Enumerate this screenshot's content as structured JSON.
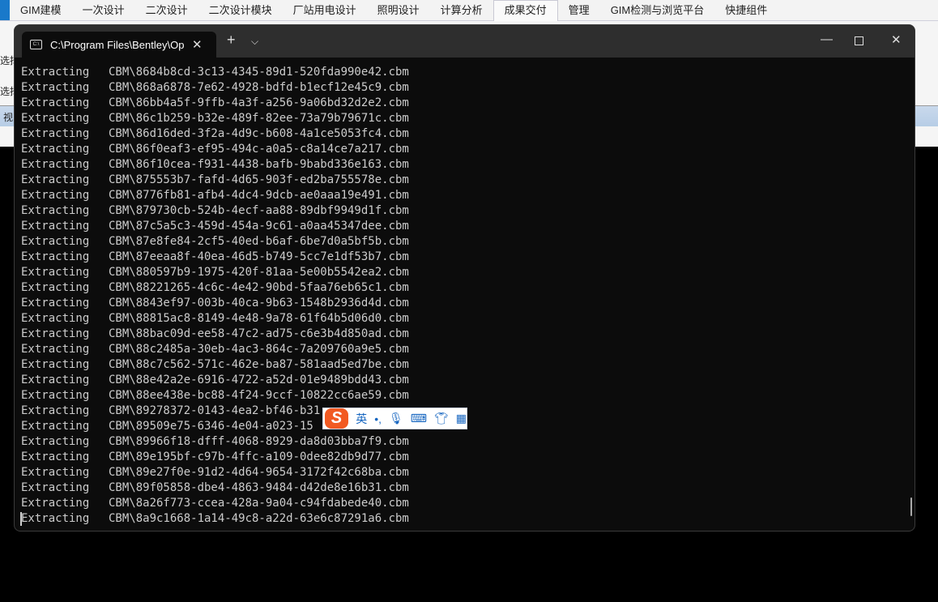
{
  "ribbon": {
    "tabs": [
      "GIM建模",
      "一次设计",
      "二次设计",
      "二次设计模块",
      "厂站用电设计",
      "照明设计",
      "计算分析",
      "成果交付",
      "管理",
      "GIM检测与浏览平台",
      "快捷组件"
    ],
    "active": "成果交付"
  },
  "background_app": {
    "labels": [
      "选择",
      "选择",
      "视"
    ]
  },
  "terminal": {
    "tab_title": "C:\\Program Files\\Bentley\\Ope",
    "tab_icon": "console-icon",
    "lines": [
      [
        "Extracting",
        "CBM\\8684b8cd-3c13-4345-89d1-520fda990e42.cbm"
      ],
      [
        "Extracting",
        "CBM\\868a6878-7e62-4928-bdfd-b1ecf12e45c9.cbm"
      ],
      [
        "Extracting",
        "CBM\\86bb4a5f-9ffb-4a3f-a256-9a06bd32d2e2.cbm"
      ],
      [
        "Extracting",
        "CBM\\86c1b259-b32e-489f-82ee-73a79b79671c.cbm"
      ],
      [
        "Extracting",
        "CBM\\86d16ded-3f2a-4d9c-b608-4a1ce5053fc4.cbm"
      ],
      [
        "Extracting",
        "CBM\\86f0eaf3-ef95-494c-a0a5-c8a14ce7a217.cbm"
      ],
      [
        "Extracting",
        "CBM\\86f10cea-f931-4438-bafb-9babd336e163.cbm"
      ],
      [
        "Extracting",
        "CBM\\875553b7-fafd-4d65-903f-ed2ba755578e.cbm"
      ],
      [
        "Extracting",
        "CBM\\8776fb81-afb4-4dc4-9dcb-ae0aaa19e491.cbm"
      ],
      [
        "Extracting",
        "CBM\\879730cb-524b-4ecf-aa88-89dbf9949d1f.cbm"
      ],
      [
        "Extracting",
        "CBM\\87c5a5c3-459d-454a-9c61-a0aa45347dee.cbm"
      ],
      [
        "Extracting",
        "CBM\\87e8fe84-2cf5-40ed-b6af-6be7d0a5bf5b.cbm"
      ],
      [
        "Extracting",
        "CBM\\87eeaa8f-40ea-46d5-b749-5cc7e1df53b7.cbm"
      ],
      [
        "Extracting",
        "CBM\\880597b9-1975-420f-81aa-5e00b5542ea2.cbm"
      ],
      [
        "Extracting",
        "CBM\\88221265-4c6c-4e42-90bd-5faa76eb65c1.cbm"
      ],
      [
        "Extracting",
        "CBM\\8843ef97-003b-40ca-9b63-1548b2936d4d.cbm"
      ],
      [
        "Extracting",
        "CBM\\88815ac8-8149-4e48-9a78-61f64b5d06d0.cbm"
      ],
      [
        "Extracting",
        "CBM\\88bac09d-ee58-47c2-ad75-c6e3b4d850ad.cbm"
      ],
      [
        "Extracting",
        "CBM\\88c2485a-30eb-4ac3-864c-7a209760a9e5.cbm"
      ],
      [
        "Extracting",
        "CBM\\88c7c562-571c-462e-ba87-581aad5ed7be.cbm"
      ],
      [
        "Extracting",
        "CBM\\88e42a2e-6916-4722-a52d-01e9489bdd43.cbm"
      ],
      [
        "Extracting",
        "CBM\\88ee438e-bc88-4f24-9ccf-10822cc6ae59.cbm"
      ],
      [
        "Extracting",
        "CBM\\89278372-0143-4ea2-bf46-b31"
      ],
      [
        "Extracting",
        "CBM\\89509e75-6346-4e04-a023-15"
      ],
      [
        "Extracting",
        "CBM\\89966f18-dfff-4068-8929-da8d03bba7f9.cbm"
      ],
      [
        "Extracting",
        "CBM\\89e195bf-c97b-4ffc-a109-0dee82db9d77.cbm"
      ],
      [
        "Extracting",
        "CBM\\89e27f0e-91d2-4d64-9654-3172f42c68ba.cbm"
      ],
      [
        "Extracting",
        "CBM\\89f05858-dbe4-4863-9484-d42de8e16b31.cbm"
      ],
      [
        "Extracting",
        "CBM\\8a26f773-ccea-428a-9a04-c94fdabede40.cbm"
      ],
      [
        "Extracting",
        "CBM\\8a9c1668-1a14-49c8-a22d-63e6c87291a6.cbm"
      ]
    ]
  },
  "ime": {
    "logo": "S",
    "mode": "英",
    "punct": "•,"
  }
}
